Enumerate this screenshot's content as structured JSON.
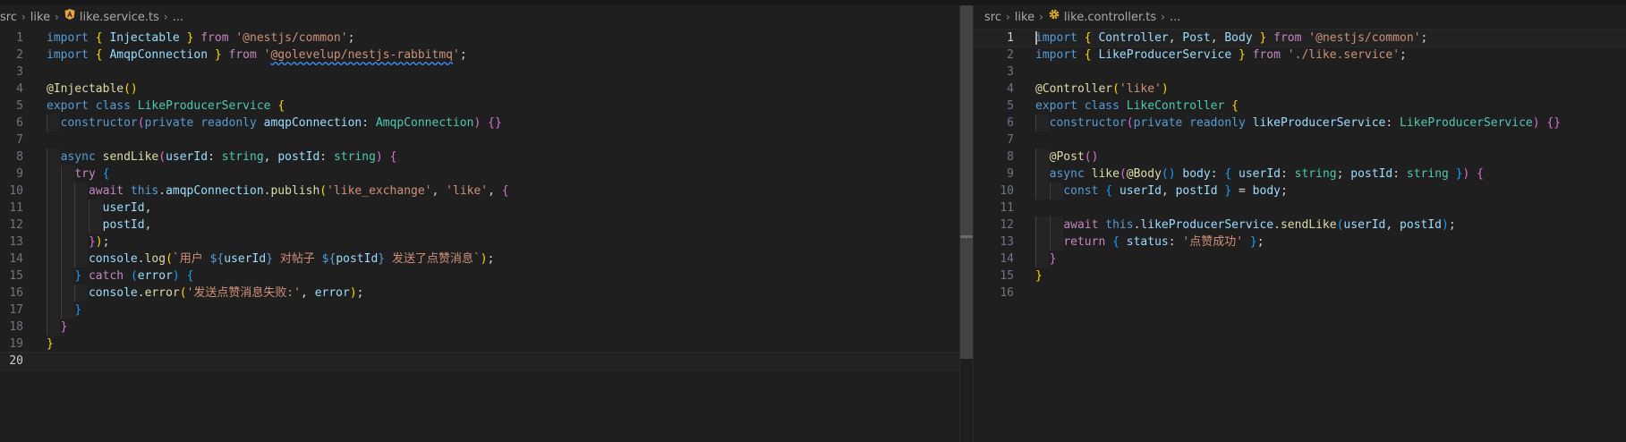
{
  "left": {
    "breadcrumb": [
      "src",
      "like",
      "like.service.ts",
      "..."
    ],
    "lines": [
      {
        "n": "1",
        "segs": [
          [
            "kw",
            "import"
          ],
          [
            "pun",
            " "
          ],
          [
            "b1",
            "{"
          ],
          [
            "pun",
            " "
          ],
          [
            "var",
            "Injectable"
          ],
          [
            "pun",
            " "
          ],
          [
            "b1",
            "}"
          ],
          [
            "pun",
            " "
          ],
          [
            "ctrl",
            "from"
          ],
          [
            "pun",
            " "
          ],
          [
            "str",
            "'@nestjs/common'"
          ],
          [
            "pun",
            ";"
          ]
        ]
      },
      {
        "n": "2",
        "segs": [
          [
            "kw",
            "import"
          ],
          [
            "pun",
            " "
          ],
          [
            "b1",
            "{"
          ],
          [
            "pun",
            " "
          ],
          [
            "var",
            "AmqpConnection"
          ],
          [
            "pun",
            " "
          ],
          [
            "b1",
            "}"
          ],
          [
            "pun",
            " "
          ],
          [
            "ctrl",
            "from"
          ],
          [
            "pun",
            " "
          ],
          [
            "str",
            "'"
          ],
          [
            "strw",
            "@golevelup/nestjs-rabbitmq"
          ],
          [
            "str",
            "'"
          ],
          [
            "pun",
            ";"
          ]
        ]
      },
      {
        "n": "3",
        "segs": []
      },
      {
        "n": "4",
        "segs": [
          [
            "fn",
            "@Injectable"
          ],
          [
            "b1",
            "()"
          ]
        ]
      },
      {
        "n": "5",
        "segs": [
          [
            "kw",
            "export"
          ],
          [
            "pun",
            " "
          ],
          [
            "kw",
            "class"
          ],
          [
            "pun",
            " "
          ],
          [
            "cls",
            "LikeProducerService"
          ],
          [
            "pun",
            " "
          ],
          [
            "b1",
            "{"
          ]
        ]
      },
      {
        "n": "6",
        "segs": [
          [
            "pun",
            "  "
          ],
          [
            "kw",
            "constructor"
          ],
          [
            "b2",
            "("
          ],
          [
            "kw",
            "private"
          ],
          [
            "pun",
            " "
          ],
          [
            "kw",
            "readonly"
          ],
          [
            "pun",
            " "
          ],
          [
            "var",
            "amqpConnection"
          ],
          [
            "pun",
            ": "
          ],
          [
            "cls",
            "AmqpConnection"
          ],
          [
            "b2",
            ")"
          ],
          [
            "pun",
            " "
          ],
          [
            "b2",
            "{}"
          ]
        ]
      },
      {
        "n": "7",
        "segs": []
      },
      {
        "n": "8",
        "segs": [
          [
            "pun",
            "  "
          ],
          [
            "kw",
            "async"
          ],
          [
            "pun",
            " "
          ],
          [
            "fn",
            "sendLike"
          ],
          [
            "b2",
            "("
          ],
          [
            "var",
            "userId"
          ],
          [
            "pun",
            ": "
          ],
          [
            "cls",
            "string"
          ],
          [
            "pun",
            ", "
          ],
          [
            "var",
            "postId"
          ],
          [
            "pun",
            ": "
          ],
          [
            "cls",
            "string"
          ],
          [
            "b2",
            ")"
          ],
          [
            "pun",
            " "
          ],
          [
            "b2",
            "{"
          ]
        ]
      },
      {
        "n": "9",
        "segs": [
          [
            "pun",
            "    "
          ],
          [
            "ctrl",
            "try"
          ],
          [
            "pun",
            " "
          ],
          [
            "b3",
            "{"
          ]
        ]
      },
      {
        "n": "10",
        "segs": [
          [
            "pun",
            "      "
          ],
          [
            "ctrl",
            "await"
          ],
          [
            "pun",
            " "
          ],
          [
            "kw",
            "this"
          ],
          [
            "pun",
            "."
          ],
          [
            "var",
            "amqpConnection"
          ],
          [
            "pun",
            "."
          ],
          [
            "fn",
            "publish"
          ],
          [
            "b1",
            "("
          ],
          [
            "str",
            "'like_exchange'"
          ],
          [
            "pun",
            ", "
          ],
          [
            "str",
            "'like'"
          ],
          [
            "pun",
            ", "
          ],
          [
            "b2",
            "{"
          ]
        ]
      },
      {
        "n": "11",
        "segs": [
          [
            "pun",
            "        "
          ],
          [
            "var",
            "userId"
          ],
          [
            "pun",
            ","
          ]
        ]
      },
      {
        "n": "12",
        "segs": [
          [
            "pun",
            "        "
          ],
          [
            "var",
            "postId"
          ],
          [
            "pun",
            ","
          ]
        ]
      },
      {
        "n": "13",
        "segs": [
          [
            "pun",
            "      "
          ],
          [
            "b2",
            "}"
          ],
          [
            "b1",
            ")"
          ],
          [
            "pun",
            ";"
          ]
        ]
      },
      {
        "n": "14",
        "segs": [
          [
            "pun",
            "      "
          ],
          [
            "var",
            "console"
          ],
          [
            "pun",
            "."
          ],
          [
            "fn",
            "log"
          ],
          [
            "b1",
            "("
          ],
          [
            "str",
            "`用户 "
          ],
          [
            "kw",
            "${"
          ],
          [
            "var",
            "userId"
          ],
          [
            "kw",
            "}"
          ],
          [
            "str",
            " 对帖子 "
          ],
          [
            "kw",
            "${"
          ],
          [
            "var",
            "postId"
          ],
          [
            "kw",
            "}"
          ],
          [
            "str",
            " 发送了点赞消息`"
          ],
          [
            "b1",
            ")"
          ],
          [
            "pun",
            ";"
          ]
        ]
      },
      {
        "n": "15",
        "segs": [
          [
            "pun",
            "    "
          ],
          [
            "b3",
            "}"
          ],
          [
            "pun",
            " "
          ],
          [
            "ctrl",
            "catch"
          ],
          [
            "pun",
            " "
          ],
          [
            "b3",
            "("
          ],
          [
            "var",
            "error"
          ],
          [
            "b3",
            ")"
          ],
          [
            "pun",
            " "
          ],
          [
            "b3",
            "{"
          ]
        ]
      },
      {
        "n": "16",
        "segs": [
          [
            "pun",
            "      "
          ],
          [
            "var",
            "console"
          ],
          [
            "pun",
            "."
          ],
          [
            "fn",
            "error"
          ],
          [
            "b1",
            "("
          ],
          [
            "str",
            "'发送点赞消息失败:'"
          ],
          [
            "pun",
            ", "
          ],
          [
            "var",
            "error"
          ],
          [
            "b1",
            ")"
          ],
          [
            "pun",
            ";"
          ]
        ]
      },
      {
        "n": "17",
        "segs": [
          [
            "pun",
            "    "
          ],
          [
            "b3",
            "}"
          ]
        ]
      },
      {
        "n": "18",
        "segs": [
          [
            "pun",
            "  "
          ],
          [
            "b2",
            "}"
          ]
        ]
      },
      {
        "n": "19",
        "segs": [
          [
            "b1",
            "}"
          ]
        ]
      },
      {
        "n": "20",
        "segs": [],
        "current": true
      }
    ]
  },
  "right": {
    "breadcrumb": [
      "src",
      "like",
      "like.controller.ts",
      "..."
    ],
    "lines": [
      {
        "n": "1",
        "segs": [
          [
            "kw",
            "import"
          ],
          [
            "pun",
            " "
          ],
          [
            "b1",
            "{"
          ],
          [
            "pun",
            " "
          ],
          [
            "var",
            "Controller"
          ],
          [
            "pun",
            ", "
          ],
          [
            "var",
            "Post"
          ],
          [
            "pun",
            ", "
          ],
          [
            "var",
            "Body"
          ],
          [
            "pun",
            " "
          ],
          [
            "b1",
            "}"
          ],
          [
            "pun",
            " "
          ],
          [
            "ctrl",
            "from"
          ],
          [
            "pun",
            " "
          ],
          [
            "str",
            "'@nestjs/common'"
          ],
          [
            "pun",
            ";"
          ]
        ],
        "current": true
      },
      {
        "n": "2",
        "segs": [
          [
            "kw",
            "import"
          ],
          [
            "pun",
            " "
          ],
          [
            "b1",
            "{"
          ],
          [
            "pun",
            " "
          ],
          [
            "var",
            "LikeProducerService"
          ],
          [
            "pun",
            " "
          ],
          [
            "b1",
            "}"
          ],
          [
            "pun",
            " "
          ],
          [
            "ctrl",
            "from"
          ],
          [
            "pun",
            " "
          ],
          [
            "str",
            "'./like.service'"
          ],
          [
            "pun",
            ";"
          ]
        ]
      },
      {
        "n": "3",
        "segs": []
      },
      {
        "n": "4",
        "segs": [
          [
            "fn",
            "@Controller"
          ],
          [
            "b1",
            "("
          ],
          [
            "str",
            "'like'"
          ],
          [
            "b1",
            ")"
          ]
        ]
      },
      {
        "n": "5",
        "segs": [
          [
            "kw",
            "export"
          ],
          [
            "pun",
            " "
          ],
          [
            "kw",
            "class"
          ],
          [
            "pun",
            " "
          ],
          [
            "cls",
            "LikeController"
          ],
          [
            "pun",
            " "
          ],
          [
            "b1",
            "{"
          ]
        ]
      },
      {
        "n": "6",
        "segs": [
          [
            "pun",
            "  "
          ],
          [
            "kw",
            "constructor"
          ],
          [
            "b2",
            "("
          ],
          [
            "kw",
            "private"
          ],
          [
            "pun",
            " "
          ],
          [
            "kw",
            "readonly"
          ],
          [
            "pun",
            " "
          ],
          [
            "var",
            "likeProducerService"
          ],
          [
            "pun",
            ": "
          ],
          [
            "cls",
            "LikeProducerService"
          ],
          [
            "b2",
            ")"
          ],
          [
            "pun",
            " "
          ],
          [
            "b2",
            "{}"
          ]
        ]
      },
      {
        "n": "7",
        "segs": []
      },
      {
        "n": "8",
        "segs": [
          [
            "pun",
            "  "
          ],
          [
            "fn",
            "@Post"
          ],
          [
            "b2",
            "()"
          ]
        ]
      },
      {
        "n": "9",
        "segs": [
          [
            "pun",
            "  "
          ],
          [
            "kw",
            "async"
          ],
          [
            "pun",
            " "
          ],
          [
            "fn",
            "like"
          ],
          [
            "b2",
            "("
          ],
          [
            "fn",
            "@Body"
          ],
          [
            "b3",
            "()"
          ],
          [
            "pun",
            " "
          ],
          [
            "var",
            "body"
          ],
          [
            "pun",
            ": "
          ],
          [
            "b3",
            "{"
          ],
          [
            "pun",
            " "
          ],
          [
            "var",
            "userId"
          ],
          [
            "pun",
            ": "
          ],
          [
            "cls",
            "string"
          ],
          [
            "pun",
            "; "
          ],
          [
            "var",
            "postId"
          ],
          [
            "pun",
            ": "
          ],
          [
            "cls",
            "string"
          ],
          [
            "pun",
            " "
          ],
          [
            "b3",
            "}"
          ],
          [
            "b2",
            ")"
          ],
          [
            "pun",
            " "
          ],
          [
            "b2",
            "{"
          ]
        ]
      },
      {
        "n": "10",
        "segs": [
          [
            "pun",
            "    "
          ],
          [
            "kw",
            "const"
          ],
          [
            "pun",
            " "
          ],
          [
            "b3",
            "{"
          ],
          [
            "pun",
            " "
          ],
          [
            "var",
            "userId"
          ],
          [
            "pun",
            ", "
          ],
          [
            "var",
            "postId"
          ],
          [
            "pun",
            " "
          ],
          [
            "b3",
            "}"
          ],
          [
            "pun",
            " = "
          ],
          [
            "var",
            "body"
          ],
          [
            "pun",
            ";"
          ]
        ]
      },
      {
        "n": "11",
        "segs": []
      },
      {
        "n": "12",
        "segs": [
          [
            "pun",
            "    "
          ],
          [
            "ctrl",
            "await"
          ],
          [
            "pun",
            " "
          ],
          [
            "kw",
            "this"
          ],
          [
            "pun",
            "."
          ],
          [
            "var",
            "likeProducerService"
          ],
          [
            "pun",
            "."
          ],
          [
            "fn",
            "sendLike"
          ],
          [
            "b3",
            "("
          ],
          [
            "var",
            "userId"
          ],
          [
            "pun",
            ", "
          ],
          [
            "var",
            "postId"
          ],
          [
            "b3",
            ")"
          ],
          [
            "pun",
            ";"
          ]
        ]
      },
      {
        "n": "13",
        "segs": [
          [
            "pun",
            "    "
          ],
          [
            "ctrl",
            "return"
          ],
          [
            "pun",
            " "
          ],
          [
            "b3",
            "{"
          ],
          [
            "pun",
            " "
          ],
          [
            "var",
            "status"
          ],
          [
            "pun",
            ": "
          ],
          [
            "str",
            "'点赞成功'"
          ],
          [
            "pun",
            " "
          ],
          [
            "b3",
            "}"
          ],
          [
            "pun",
            ";"
          ]
        ]
      },
      {
        "n": "14",
        "segs": [
          [
            "pun",
            "  "
          ],
          [
            "b2",
            "}"
          ]
        ]
      },
      {
        "n": "15",
        "segs": [
          [
            "b1",
            "}"
          ]
        ]
      },
      {
        "n": "16",
        "segs": []
      }
    ]
  },
  "icons": {
    "left_file_icon": "angular-service-icon",
    "right_file_icon": "gear-icon",
    "lightbulb": "lightbulb-icon"
  },
  "colors": {
    "background": "#1f1f1f",
    "keyword": "#569cd6",
    "control": "#c586c0",
    "type": "#4ec9b0",
    "function": "#dcdcaa",
    "variable": "#9cdcfe",
    "string": "#ce9178"
  }
}
